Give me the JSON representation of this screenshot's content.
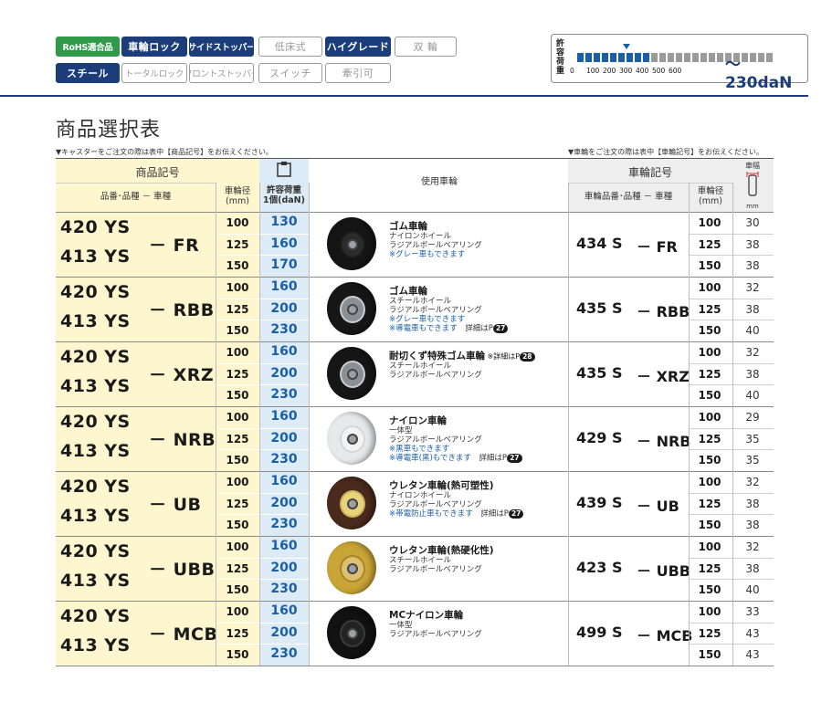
{
  "features": [
    {
      "label": "RoHS適合品",
      "state": "green",
      "small": true
    },
    {
      "label": "車輪ロック",
      "state": "blue"
    },
    {
      "label": "サイドストッパー",
      "state": "blue",
      "small": true
    },
    {
      "label": "低床式",
      "state": "off"
    },
    {
      "label": "ハイグレード",
      "state": "blue"
    },
    {
      "label": "双 輪",
      "state": "off"
    },
    {
      "label": "スチール",
      "state": "blue"
    },
    {
      "label": "トータルロック",
      "state": "off",
      "small": true
    },
    {
      "label": "フロントストッパー",
      "state": "off",
      "small": true
    },
    {
      "label": "スイッチ",
      "state": "off"
    },
    {
      "label": "牽引可",
      "state": "off"
    }
  ],
  "load_scale": {
    "label": "許容荷重",
    "ticks": [
      "0",
      "100",
      "200",
      "300",
      "400",
      "500",
      "600"
    ],
    "value_text": "～230daN",
    "value": 230,
    "colors": {
      "filled": "#1b5fa8",
      "empty": "#9a9a9a"
    }
  },
  "page_title": "商品選択表",
  "note_left": "▼キャスターをご注文の際は表中【商品記号】をお伝えください。",
  "note_right": "▼車輪をご注文の際は表中【車輪記号】をお伝えください。",
  "header": {
    "product_code": "商品記号",
    "product_sub": "品番･品種 － 車種",
    "diameter": "車輪径",
    "diameter_unit": "(mm)",
    "load": "許容荷重",
    "load_unit": "1個(daN)",
    "wheel_used": "使用車輪",
    "wheel_code": "車輪記号",
    "wheel_sub": "車輪品番･品種 － 車種",
    "wheel_diameter": "車輪径",
    "wheel_diameter_unit": "(mm)",
    "wheel_width": "車幅",
    "wheel_width_unit": "mm"
  },
  "rows": [
    {
      "models": [
        "420 YS",
        "413 YS"
      ],
      "suffix": "－ FR",
      "dias": [
        "100",
        "125",
        "150"
      ],
      "loads": [
        "130",
        "160",
        "170"
      ],
      "wheel_name": "ゴム車輪",
      "wheel_note": "",
      "desc": [
        "ナイロンホイール",
        "ラジアルボールベアリング"
      ],
      "blue": [
        "※グレー車もできます"
      ],
      "ref": "",
      "wheel_code": "434 S",
      "wheel_suffix": "－ FR",
      "widths": [
        "30",
        "38",
        "38"
      ],
      "style": "black-nylon"
    },
    {
      "models": [
        "420 YS",
        "413 YS"
      ],
      "suffix": "－ RBB",
      "dias": [
        "100",
        "125",
        "150"
      ],
      "loads": [
        "160",
        "200",
        "230"
      ],
      "wheel_name": "ゴム車輪",
      "wheel_note": "",
      "desc": [
        "スチールホイール",
        "ラジアルボールベアリング"
      ],
      "blue": [
        "※グレー車もできます",
        "※導電車もできます"
      ],
      "ref": "詳細はP",
      "ref_page": "27",
      "wheel_code": "435 S",
      "wheel_suffix": "－ RBB",
      "widths": [
        "32",
        "38",
        "40"
      ],
      "style": "black-steel"
    },
    {
      "models": [
        "420 YS",
        "413 YS"
      ],
      "suffix": "－ XRZ",
      "dias": [
        "100",
        "125",
        "150"
      ],
      "loads": [
        "160",
        "200",
        "230"
      ],
      "wheel_name": "耐切くず特殊ゴム車輪",
      "wheel_note": "※詳細はP",
      "wheel_note_page": "28",
      "desc": [
        "スチールホイール",
        "ラジアルボールベアリング"
      ],
      "blue": [],
      "ref": "",
      "wheel_code": "435 S",
      "wheel_suffix": "－ XRZ",
      "widths": [
        "32",
        "38",
        "40"
      ],
      "style": "black-steel"
    },
    {
      "models": [
        "420 YS",
        "413 YS"
      ],
      "suffix": "－ NRB",
      "dias": [
        "100",
        "125",
        "150"
      ],
      "loads": [
        "160",
        "200",
        "230"
      ],
      "wheel_name": "ナイロン車輪",
      "wheel_note": "",
      "desc": [
        "一体型",
        "ラジアルボールベアリング"
      ],
      "blue": [
        "※黒車もできます",
        "※導電車(黒)もできます"
      ],
      "ref": "詳細はP",
      "ref_page": "27",
      "wheel_code": "429 S",
      "wheel_suffix": "－ NRB",
      "widths": [
        "29",
        "35",
        "35"
      ],
      "style": "white"
    },
    {
      "models": [
        "420 YS",
        "413 YS"
      ],
      "suffix": "－ UB",
      "dias": [
        "100",
        "125",
        "150"
      ],
      "loads": [
        "160",
        "200",
        "230"
      ],
      "wheel_name": "ウレタン車輪(熱可塑性)",
      "wheel_note": "",
      "desc": [
        "ナイロンホイール",
        "ラジアルボールベアリング"
      ],
      "blue": [
        "※帯電防止車もできます"
      ],
      "ref": "詳細はP",
      "ref_page": "27",
      "wheel_code": "439 S",
      "wheel_suffix": "－ UB",
      "widths": [
        "32",
        "38",
        "38"
      ],
      "style": "brown"
    },
    {
      "models": [
        "420 YS",
        "413 YS"
      ],
      "suffix": "－ UBB",
      "dias": [
        "100",
        "125",
        "150"
      ],
      "loads": [
        "160",
        "200",
        "230"
      ],
      "wheel_name": "ウレタン車輪(熱硬化性)",
      "wheel_note": "",
      "desc": [
        "スチールホイール",
        "ラジアルボールベアリング"
      ],
      "blue": [],
      "ref": "",
      "wheel_code": "423 S",
      "wheel_suffix": "－ UBB",
      "widths": [
        "32",
        "38",
        "40"
      ],
      "style": "amber"
    },
    {
      "models": [
        "420 YS",
        "413 YS"
      ],
      "suffix": "－ MCB",
      "dias": [
        "100",
        "125",
        "150"
      ],
      "loads": [
        "160",
        "200",
        "230"
      ],
      "wheel_name": "MCナイロン車輪",
      "wheel_note": "",
      "desc": [
        "一体型",
        "ラジアルボールベアリング"
      ],
      "blue": [],
      "ref": "",
      "wheel_code": "499 S",
      "wheel_suffix": "－ MCB",
      "widths": [
        "33",
        "43",
        "43"
      ],
      "style": "black-plain"
    }
  ]
}
